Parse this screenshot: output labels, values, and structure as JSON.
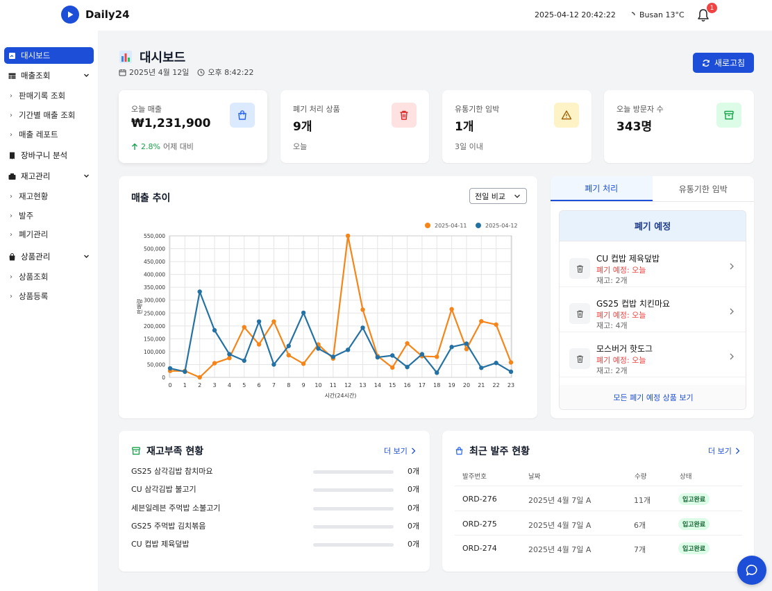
{
  "app": {
    "name": "Daily24"
  },
  "header": {
    "datetime": "2025-04-12 20:42:22",
    "weather": "Busan 13°C",
    "notifications": "1"
  },
  "sidebar": {
    "dashboard": "대시보드",
    "sales": {
      "label": "매출조회",
      "items": [
        "판매기록 조회",
        "기간별 매출 조회",
        "매출 레포트"
      ]
    },
    "basket": "장바구니 분석",
    "inventory": {
      "label": "재고관리",
      "items": [
        "재고현황",
        "발주",
        "폐기관리"
      ]
    },
    "products": {
      "label": "상품관리",
      "items": [
        "상품조회",
        "상품등록"
      ]
    }
  },
  "page": {
    "title": "대시보드",
    "date": "2025년 4월 12일",
    "time": "오후 8:42:22",
    "refresh": "새로고침"
  },
  "stats": [
    {
      "label": "오늘 매출",
      "value": "₩1,231,900",
      "change": "2.8%",
      "change_label": "어제 대비",
      "icon": "shopping-bag-icon",
      "color": "#2563eb"
    },
    {
      "label": "폐기 처리 상품",
      "value": "9개",
      "sub": "오늘",
      "icon": "trash-icon",
      "color": "#dc2626"
    },
    {
      "label": "유통기한 임박",
      "value": "1개",
      "sub": "3일 이내",
      "icon": "warning-icon",
      "color": "#ca8a04"
    },
    {
      "label": "오늘 방문자 수",
      "value": "343명",
      "icon": "archive-icon",
      "color": "#16a34a"
    }
  ],
  "sales_trend": {
    "title": "매출 추이",
    "compare": "전일 비교"
  },
  "chart_data": {
    "type": "line",
    "title": "",
    "xlabel": "시간(24시간)",
    "ylabel": "판매량",
    "x": [
      0,
      1,
      2,
      3,
      4,
      5,
      6,
      7,
      8,
      9,
      10,
      11,
      12,
      13,
      14,
      15,
      16,
      17,
      18,
      19,
      20,
      21,
      22,
      23
    ],
    "ylim": [
      0,
      550000
    ],
    "yticks": [
      "0",
      "50,000",
      "100,000",
      "150,000",
      "200,000",
      "250,000",
      "300,000",
      "350,000",
      "400,000",
      "450,000",
      "500,000",
      "550,000"
    ],
    "legend": "top-right",
    "grid": true,
    "series": [
      {
        "name": "2025-04-11",
        "color": "#f58518",
        "values": [
          25000,
          25000,
          0,
          55000,
          75000,
          195000,
          128000,
          217000,
          86000,
          53000,
          128000,
          73000,
          550000,
          263000,
          83000,
          38000,
          132000,
          82000,
          80000,
          265000,
          110000,
          218000,
          205000,
          58000
        ]
      },
      {
        "name": "2025-04-12",
        "color": "#2471a3",
        "values": [
          35000,
          22000,
          333000,
          183000,
          90000,
          65000,
          217000,
          50000,
          122000,
          251000,
          112000,
          80000,
          107000,
          193000,
          78000,
          85000,
          40000,
          90000,
          18000,
          118000,
          131000,
          37000,
          56000,
          22000
        ]
      }
    ]
  },
  "disposal": {
    "tabs": [
      "폐기 처리",
      "유통기한 임박"
    ],
    "heading": "폐기 예정",
    "items": [
      {
        "name": "CU 컵밥 제육덮밥",
        "due": "폐기 예정: 오늘",
        "stock": "재고: 2개"
      },
      {
        "name": "GS25 컵밥 치킨마요",
        "due": "폐기 예정: 오늘",
        "stock": "재고: 4개"
      },
      {
        "name": "모스버거 핫도그",
        "due": "폐기 예정: 오늘",
        "stock": "재고: 2개"
      }
    ],
    "footer": "모든 폐기 예정 상품 보기"
  },
  "low_stock": {
    "title": "재고부족 현황",
    "more": "더 보기",
    "items": [
      {
        "name": "GS25 삼각김밥 참치마요",
        "qty": "0개"
      },
      {
        "name": "CU 삼각김밥 불고기",
        "qty": "0개"
      },
      {
        "name": "세븐일레븐 주먹밥 소불고기",
        "qty": "0개"
      },
      {
        "name": "GS25 주먹밥 김치볶음",
        "qty": "0개"
      },
      {
        "name": "CU 컵밥 제육덮밥",
        "qty": "0개"
      }
    ]
  },
  "orders": {
    "title": "최근 발주 현황",
    "more": "더 보기",
    "columns": [
      "발주번호",
      "날짜",
      "수량",
      "상태"
    ],
    "rows": [
      {
        "id": "ORD-276",
        "date": "2025년 4월 7일 A",
        "qty": "11개",
        "status": "입고완료"
      },
      {
        "id": "ORD-275",
        "date": "2025년 4월 7일 A",
        "qty": "6개",
        "status": "입고완료"
      },
      {
        "id": "ORD-274",
        "date": "2025년 4월 7일 A",
        "qty": "7개",
        "status": "입고완료"
      }
    ]
  }
}
